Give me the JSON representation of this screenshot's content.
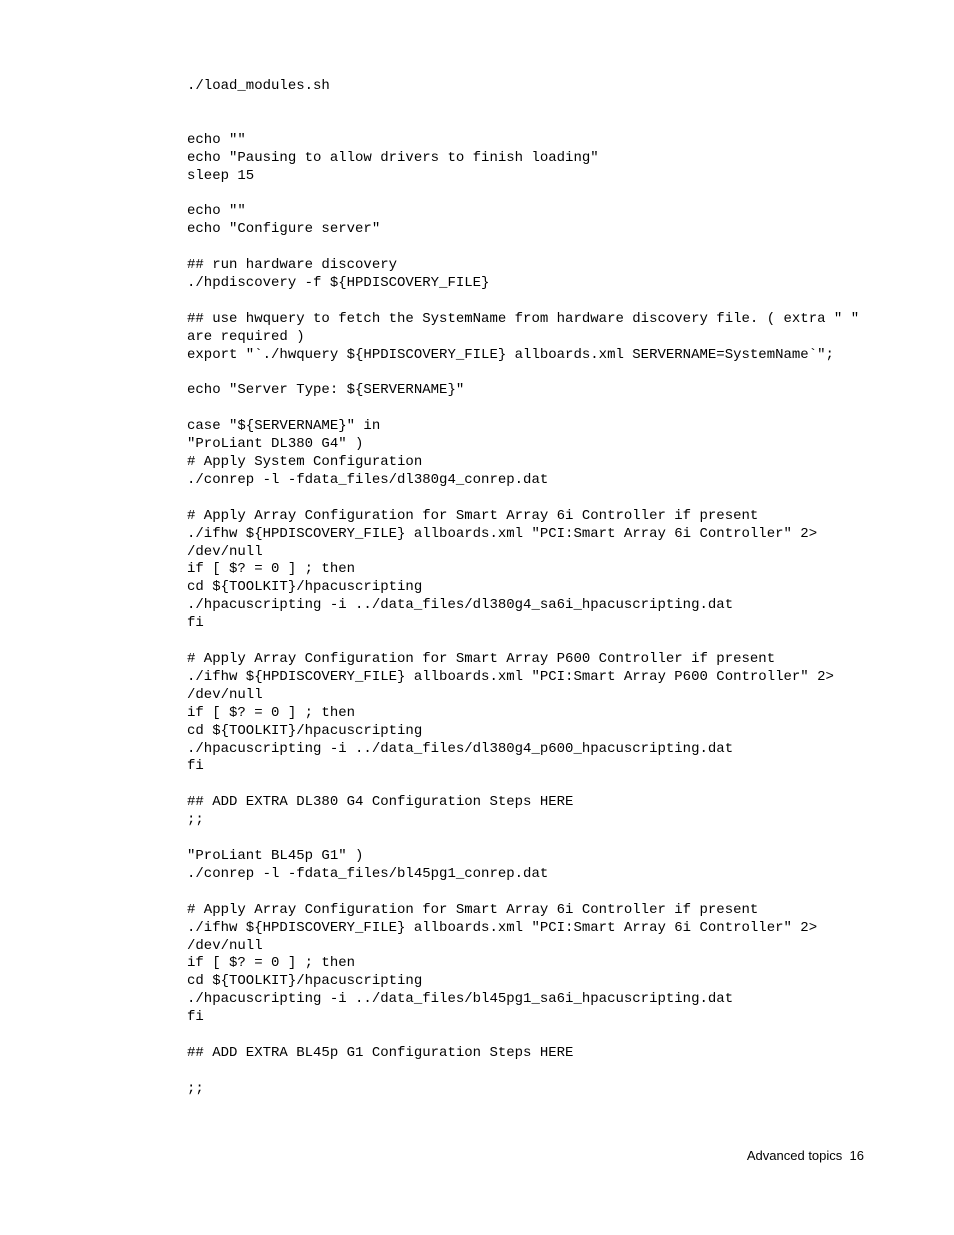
{
  "code": "./load_modules.sh\n\n\necho \"\"\necho \"Pausing to allow drivers to finish loading\"\nsleep 15\n\necho \"\"\necho \"Configure server\"\n\n## run hardware discovery\n./hpdiscovery -f ${HPDISCOVERY_FILE}\n\n## use hwquery to fetch the SystemName from hardware discovery file. ( extra \" \" are required )\nexport \"`./hwquery ${HPDISCOVERY_FILE} allboards.xml SERVERNAME=SystemName`\";\n\necho \"Server Type: ${SERVERNAME}\"\n\ncase \"${SERVERNAME}\" in\n\"ProLiant DL380 G4\" )\n# Apply System Configuration\n./conrep -l -fdata_files/dl380g4_conrep.dat\n\n# Apply Array Configuration for Smart Array 6i Controller if present\n./ifhw ${HPDISCOVERY_FILE} allboards.xml \"PCI:Smart Array 6i Controller\" 2> /dev/null\nif [ $? = 0 ] ; then\ncd ${TOOLKIT}/hpacuscripting\n./hpacuscripting -i ../data_files/dl380g4_sa6i_hpacuscripting.dat\nfi\n\n# Apply Array Configuration for Smart Array P600 Controller if present\n./ifhw ${HPDISCOVERY_FILE} allboards.xml \"PCI:Smart Array P600 Controller\" 2> /dev/null\nif [ $? = 0 ] ; then\ncd ${TOOLKIT}/hpacuscripting\n./hpacuscripting -i ../data_files/dl380g4_p600_hpacuscripting.dat\nfi\n\n## ADD EXTRA DL380 G4 Configuration Steps HERE\n;;\n\n\"ProLiant BL45p G1\" )\n./conrep -l -fdata_files/bl45pg1_conrep.dat\n\n# Apply Array Configuration for Smart Array 6i Controller if present\n./ifhw ${HPDISCOVERY_FILE} allboards.xml \"PCI:Smart Array 6i Controller\" 2> /dev/null\nif [ $? = 0 ] ; then\ncd ${TOOLKIT}/hpacuscripting\n./hpacuscripting -i ../data_files/bl45pg1_sa6i_hpacuscripting.dat\nfi\n\n## ADD EXTRA BL45p G1 Configuration Steps HERE\n\n;;",
  "footer": {
    "section": "Advanced topics",
    "page": "16"
  }
}
